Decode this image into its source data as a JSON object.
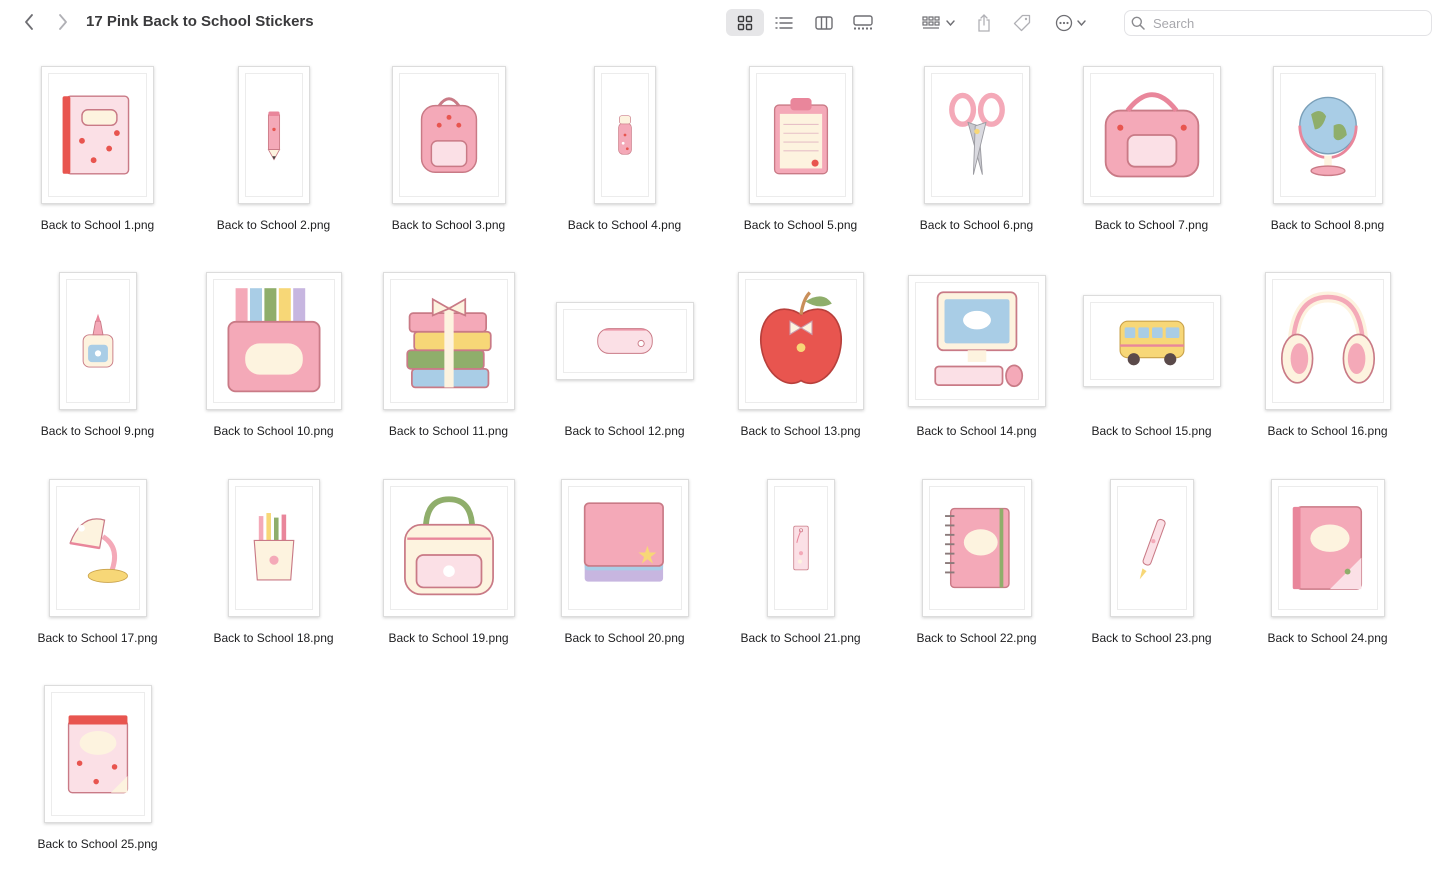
{
  "window": {
    "title": "17 Pink Back to School Stickers"
  },
  "toolbar": {
    "back_icon": "chevron-left-icon",
    "forward_icon": "chevron-right-icon",
    "view_modes": [
      "icon-view",
      "list-view",
      "column-view",
      "gallery-view"
    ],
    "active_view": "icon-view",
    "group_icon": "group-by-icon",
    "share_icon": "share-icon",
    "tag_icon": "tag-icon",
    "more_icon": "ellipsis-circle-icon",
    "search": {
      "placeholder": "Search",
      "value": ""
    }
  },
  "colors": {
    "accent_pink": "#f4a9b8",
    "light_pink": "#fbe0e6",
    "cream": "#fdf3df"
  },
  "files": [
    {
      "name": "Back to School 1.png",
      "icon": "notebook-icon"
    },
    {
      "name": "Back to School 2.png",
      "icon": "pencil-icon"
    },
    {
      "name": "Back to School 3.png",
      "icon": "backpack-icon"
    },
    {
      "name": "Back to School 4.png",
      "icon": "water-bottle-icon"
    },
    {
      "name": "Back to School 5.png",
      "icon": "clipboard-icon"
    },
    {
      "name": "Back to School 6.png",
      "icon": "scissors-icon"
    },
    {
      "name": "Back to School 7.png",
      "icon": "lunch-bag-icon"
    },
    {
      "name": "Back to School 8.png",
      "icon": "globe-icon"
    },
    {
      "name": "Back to School 9.png",
      "icon": "glue-bottle-icon"
    },
    {
      "name": "Back to School 10.png",
      "icon": "crayon-box-icon"
    },
    {
      "name": "Back to School 11.png",
      "icon": "book-stack-icon"
    },
    {
      "name": "Back to School 12.png",
      "icon": "pencil-case-icon"
    },
    {
      "name": "Back to School 13.png",
      "icon": "apple-icon"
    },
    {
      "name": "Back to School 14.png",
      "icon": "computer-icon"
    },
    {
      "name": "Back to School 15.png",
      "icon": "school-bus-icon"
    },
    {
      "name": "Back to School 16.png",
      "icon": "headphones-icon"
    },
    {
      "name": "Back to School 17.png",
      "icon": "desk-lamp-icon"
    },
    {
      "name": "Back to School 18.png",
      "icon": "pencil-cup-icon"
    },
    {
      "name": "Back to School 19.png",
      "icon": "handbag-icon"
    },
    {
      "name": "Back to School 20.png",
      "icon": "sticky-notes-icon"
    },
    {
      "name": "Back to School 21.png",
      "icon": "bookmark-icon"
    },
    {
      "name": "Back to School 22.png",
      "icon": "spiral-notebook-icon"
    },
    {
      "name": "Back to School 23.png",
      "icon": "pen-icon"
    },
    {
      "name": "Back to School 24.png",
      "icon": "journal-icon"
    },
    {
      "name": "Back to School 25.png",
      "icon": "memo-pad-icon"
    }
  ]
}
